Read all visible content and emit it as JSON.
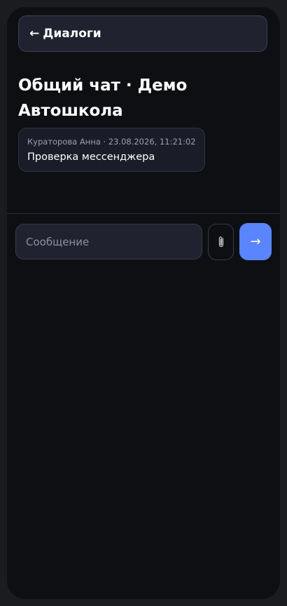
{
  "header": {
    "back_arrow": "←",
    "back_label": "Диалоги"
  },
  "chat": {
    "title": "Общий чат · Демо Автошкола"
  },
  "messages": [
    {
      "meta": "Кураторова Анна · 23.08.2026, 11:21:02",
      "text": "Проверка мессенджера"
    }
  ],
  "composer": {
    "placeholder": "Сообщение",
    "value": "",
    "attach_icon": "paperclip-icon",
    "send_icon": "arrow-right-icon",
    "send_glyph": "→"
  },
  "colors": {
    "accent": "#5b84ff",
    "background": "#0e0f13",
    "surface": "#20232f"
  }
}
